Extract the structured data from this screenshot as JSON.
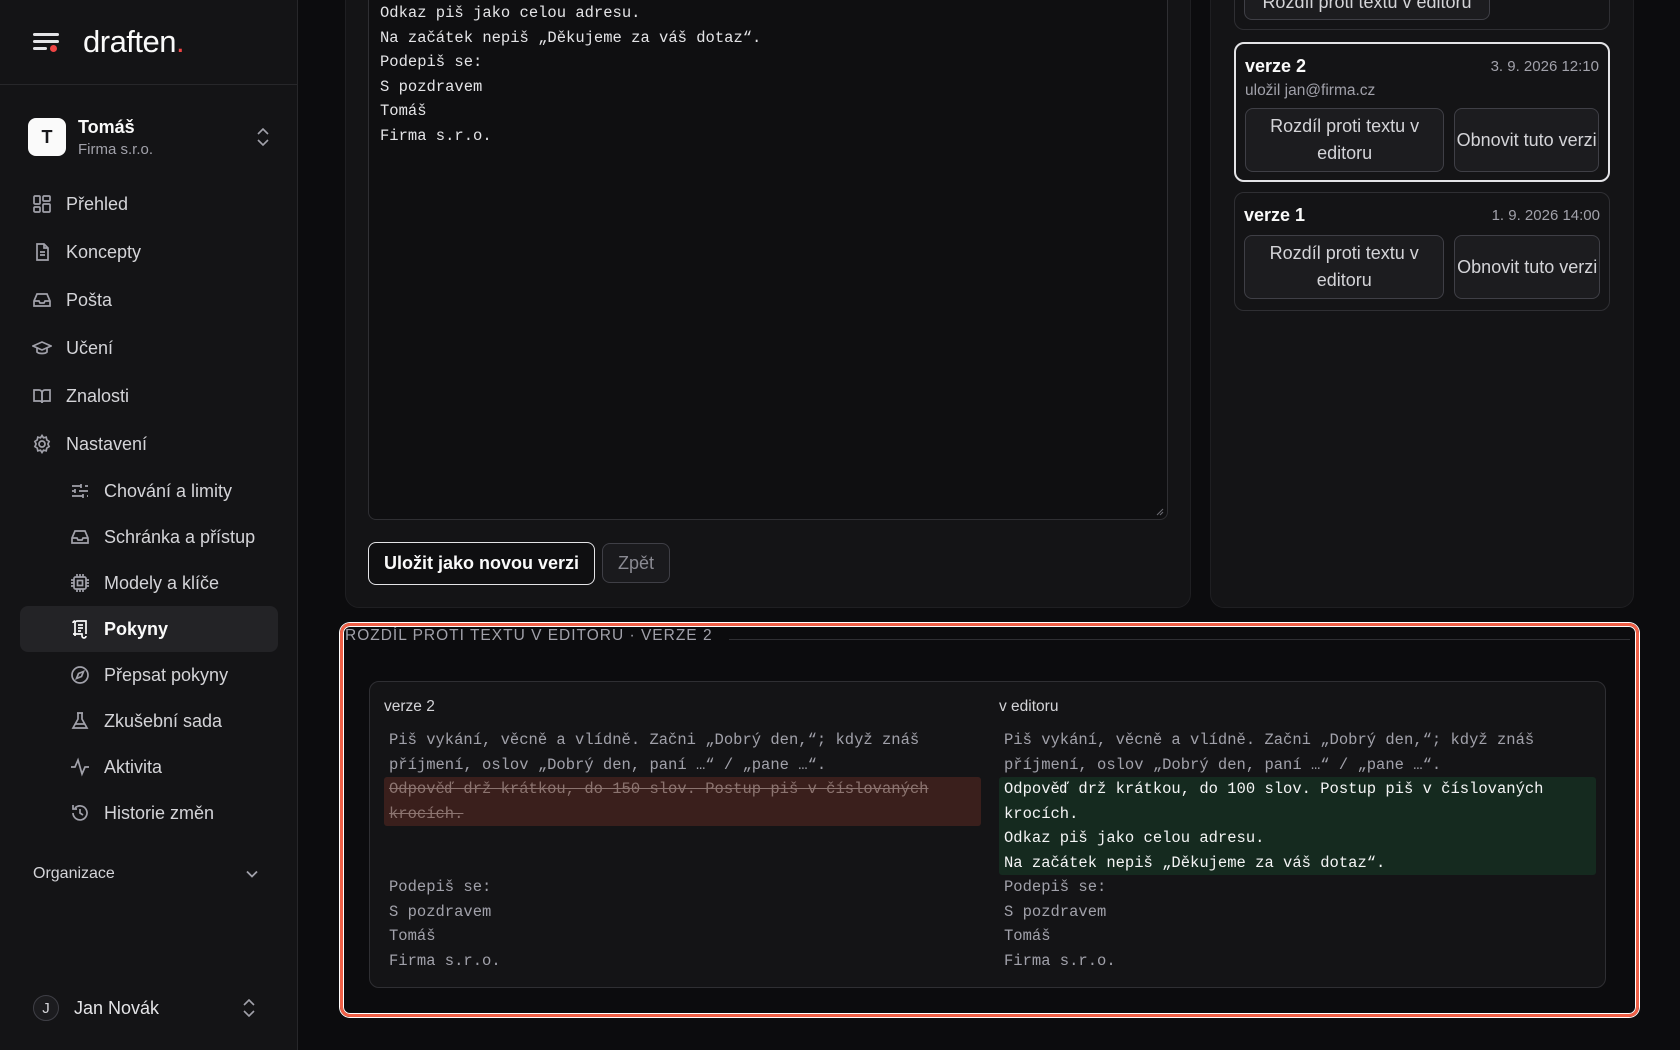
{
  "brand": {
    "name": "draften",
    "dot": "."
  },
  "workspace": {
    "initial": "T",
    "name": "Tomáš",
    "org": "Firma s.r.o."
  },
  "nav": {
    "items": [
      {
        "label": "Přehled",
        "icon": "dashboard-icon"
      },
      {
        "label": "Koncepty",
        "icon": "file-text-icon"
      },
      {
        "label": "Pošta",
        "icon": "inbox-icon"
      },
      {
        "label": "Učení",
        "icon": "graduation-cap-icon"
      },
      {
        "label": "Znalosti",
        "icon": "book-open-icon"
      },
      {
        "label": "Nastavení",
        "icon": "gear-icon"
      }
    ],
    "sub_items": [
      {
        "label": "Chování a limity",
        "icon": "sliders-icon"
      },
      {
        "label": "Schránka a přístup",
        "icon": "inbox-icon"
      },
      {
        "label": "Modely a klíče",
        "icon": "cpu-icon"
      },
      {
        "label": "Pokyny",
        "icon": "scroll-text-icon",
        "active": true
      },
      {
        "label": "Přepsat pokyny",
        "icon": "compass-icon"
      },
      {
        "label": "Zkušební sada",
        "icon": "flask-icon"
      },
      {
        "label": "Aktivita",
        "icon": "activity-icon"
      },
      {
        "label": "Historie změn",
        "icon": "history-icon"
      }
    ],
    "org_section": "Organizace"
  },
  "user": {
    "initial": "J",
    "name": "Jan Novák"
  },
  "editor": {
    "text": "Odkaz piš jako celou adresu.\nNa začátek nepiš „Děkujeme za váš dotaz“.\nPodepiš se:\nS pozdravem\nTomáš\nFirma s.r.o.",
    "save_label": "Uložit jako novou verzi",
    "back_label": "Zpět"
  },
  "versions": {
    "top_partial_button": "Rozdíl proti textu v editoru",
    "items": [
      {
        "title": "verze 2",
        "date": "3. 9. 2026 12:10",
        "saved_by": "uložil jan@firma.cz",
        "diff_label": "Rozdíl proti textu v editoru",
        "restore_label": "Obnovit tuto verzi"
      },
      {
        "title": "verze 1",
        "date": "1. 9. 2026 14:00",
        "diff_label": "Rozdíl proti textu v editoru",
        "restore_label": "Obnovit tuto verzi"
      }
    ]
  },
  "diff": {
    "title": "ROZDÍL PROTI TEXTU V EDITORU · VERZE 2",
    "left_label": "verze 2",
    "right_label": "v editoru",
    "left": {
      "common_before": [
        "Piš vykání, věcně a vlídně. Začni „Dobrý den,“; když znáš",
        "příjmení, oslov „Dobrý den, paní …“ / „pane …“."
      ],
      "removed": [
        "Odpověď drž krátkou, do 150 slov. Postup piš v číslovaných",
        "krocích."
      ],
      "common_after": [
        "Podepiš se:",
        "S pozdravem",
        "Tomáš",
        "Firma s.r.o."
      ]
    },
    "right": {
      "common_before": [
        "Piš vykání, věcně a vlídně. Začni „Dobrý den,“; když znáš",
        "příjmení, oslov „Dobrý den, paní …“ / „pane …“."
      ],
      "added": [
        "Odpověď drž krátkou, do 100 slov. Postup piš v číslovaných",
        "krocích.",
        "Odkaz piš jako celou adresu.",
        "Na začátek nepiš „Děkujeme za váš dotaz“."
      ],
      "common_after": [
        "Podepiš se:",
        "S pozdravem",
        "Tomáš",
        "Firma s.r.o."
      ]
    }
  },
  "colors": {
    "accent_red": "#ef4444",
    "highlight": "#f06047",
    "removed_bg": "#3a1f1c",
    "added_bg": "#152a1f"
  }
}
